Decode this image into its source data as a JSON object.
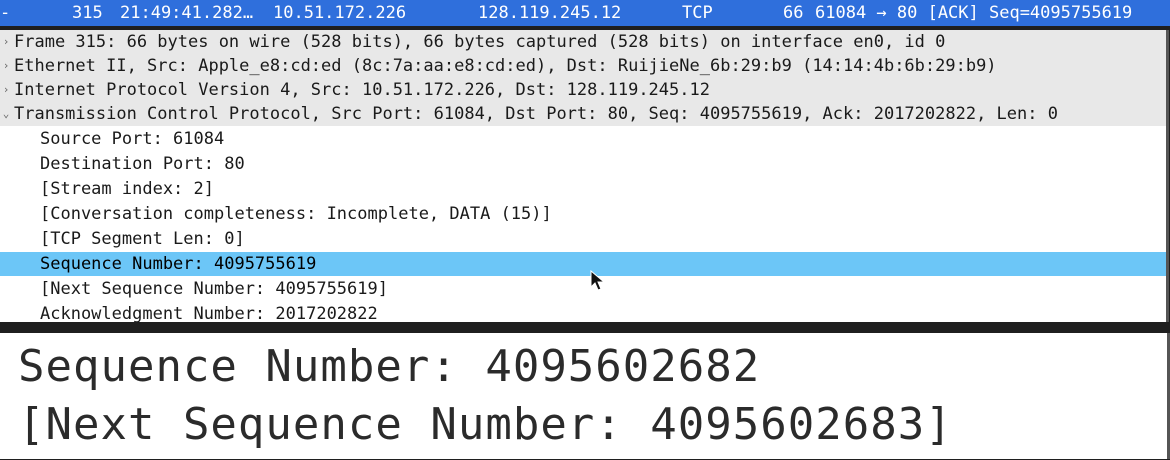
{
  "packet_list": {
    "selected_row": {
      "number": "315",
      "time": "21:49:41.282…",
      "source": "10.51.172.226",
      "destination": "128.119.245.12",
      "protocol": "TCP",
      "length": "66",
      "info": "61084 → 80 [ACK] Seq=4095755619"
    }
  },
  "details": {
    "frame": "Frame 315: 66 bytes on wire (528 bits), 66 bytes captured (528 bits) on interface en0, id 0",
    "ethernet": "Ethernet II, Src: Apple_e8:cd:ed (8c:7a:aa:e8:cd:ed), Dst: RuijieNe_6b:29:b9 (14:14:4b:6b:29:b9)",
    "ip": "Internet Protocol Version 4, Src: 10.51.172.226, Dst: 128.119.245.12",
    "tcp": "Transmission Control Protocol, Src Port: 61084, Dst Port: 80, Seq: 4095755619, Ack: 2017202822, Len: 0",
    "tcp_fields": [
      "Source Port: 61084",
      "Destination Port: 80",
      "[Stream index: 2]",
      "[Conversation completeness: Incomplete, DATA (15)]",
      "[TCP Segment Len: 0]",
      "Sequence Number: 4095755619",
      "[Next Sequence Number: 4095755619]",
      "Acknowledgment Number: 2017202822"
    ]
  },
  "zoom": {
    "line1": "Sequence Number: 4095602682",
    "line2": "[Next Sequence Number: 4095602683]"
  },
  "colors": {
    "selected_packet_row": "#2f6fdc",
    "selected_field_row": "#6cc6f7"
  }
}
